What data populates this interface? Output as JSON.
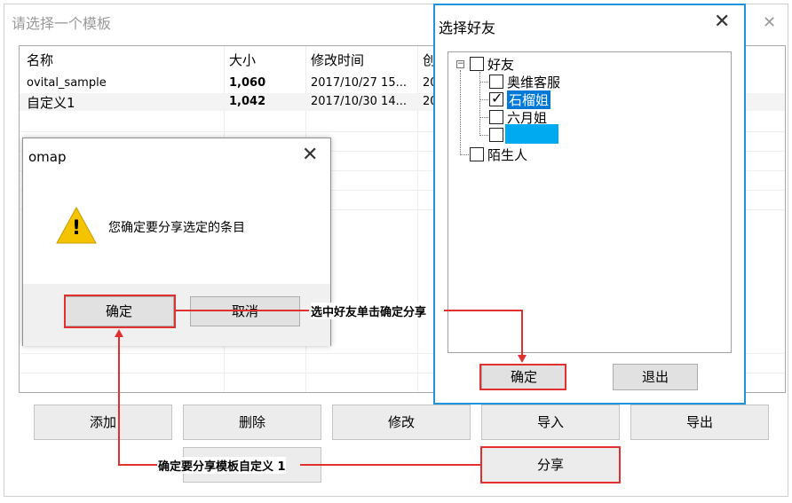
{
  "main_window": {
    "title": "请选择一个模板",
    "close_glyph": "✕",
    "columns": [
      "名称",
      "大小",
      "修改时间",
      "创"
    ],
    "rows": [
      {
        "name": "ovital_sample",
        "size": "1,060",
        "modified": "2017/10/27 15...",
        "created": "20"
      },
      {
        "name": "自定义1",
        "size": "1,042",
        "modified": "2017/10/30 14...",
        "created": "20"
      }
    ],
    "buttons": {
      "add": "添加",
      "delete": "删除",
      "edit": "修改",
      "import": "导入",
      "export": "导出",
      "share": "分享"
    }
  },
  "confirm_dialog": {
    "title": "omap",
    "close_glyph": "✕",
    "warning_glyph": "!",
    "message": "您确定要分享选定的条目",
    "ok_label": "确定",
    "cancel_label": "取消"
  },
  "friend_dialog": {
    "title": "选择好友",
    "close_glyph": "✕",
    "tree": {
      "expander_glyph": "−",
      "root": {
        "label": "好友",
        "checked": false
      },
      "children": [
        {
          "label": "奥维客服",
          "checked": false
        },
        {
          "label": "石榴姐",
          "checked": true,
          "selected": true
        },
        {
          "label": "六月姐",
          "checked": false
        },
        {
          "label": "",
          "checked": false
        }
      ],
      "strangers": {
        "label": "陌生人",
        "checked": false
      }
    },
    "check_glyph": "✓",
    "ok_label": "确定",
    "exit_label": "退出"
  },
  "annotations": {
    "select_friend_note": "选中好友单击确定分享",
    "confirm_share_note": "确定要分享模板自定义 1"
  },
  "colors": {
    "annotation_red": "#e03030",
    "selection_blue": "#0078d7",
    "dialog_border_blue": "#1f93dc",
    "warning_yellow": "#f5c400"
  }
}
